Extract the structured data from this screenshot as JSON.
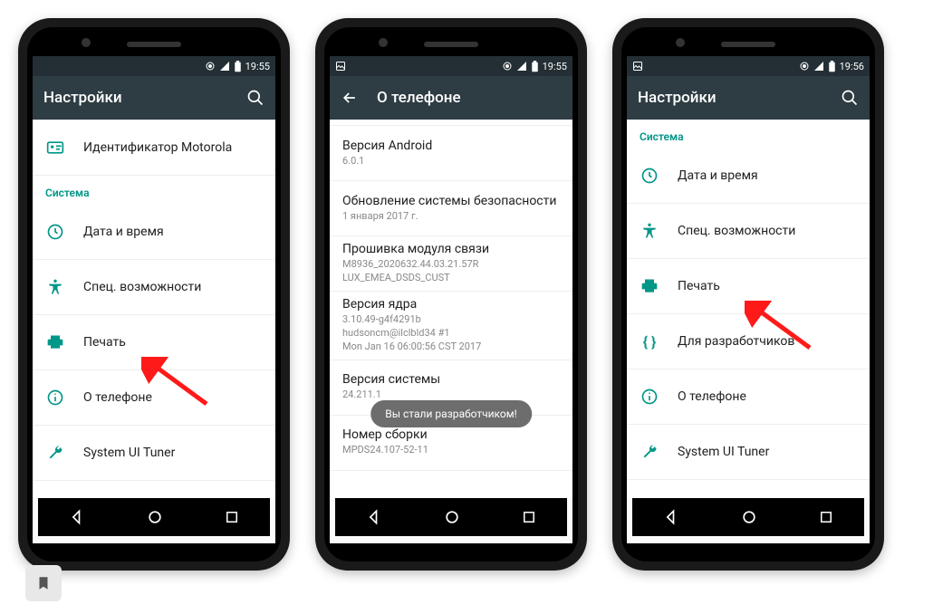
{
  "colors": {
    "accent": "#009688",
    "appbar": "#2e3c43",
    "statusbar": "#232f34"
  },
  "phone1": {
    "time": "19:55",
    "title": "Настройки",
    "top_item": "Идентификатор Motorola",
    "section": "Система",
    "items": [
      {
        "label": "Дата и время",
        "icon": "clock"
      },
      {
        "label": "Спец. возможности",
        "icon": "accessibility"
      },
      {
        "label": "Печать",
        "icon": "print"
      },
      {
        "label": "О телефоне",
        "icon": "info"
      },
      {
        "label": "System UI Tuner",
        "icon": "wrench"
      }
    ]
  },
  "phone2": {
    "time": "19:55",
    "title": "О телефоне",
    "toast": "Вы стали разработчиком!",
    "items": [
      {
        "title": "Версия Android",
        "sub": "6.0.1"
      },
      {
        "title": "Обновление системы безопасности",
        "sub": "1 января 2017 г."
      },
      {
        "title": "Прошивка модуля связи",
        "sub": "M8936_2020632.44.03.21.57R\nLUX_EMEA_DSDS_CUST"
      },
      {
        "title": "Версия ядра",
        "sub": "3.10.49-g4f4291b\nhudsoncm@ilclbld34 #1\nMon Jan 16 06:00:56 CST 2017"
      },
      {
        "title": "Версия системы",
        "sub": "24.211.1"
      },
      {
        "title": "Номер сборки",
        "sub": "MPDS24.107-52-11"
      }
    ]
  },
  "phone3": {
    "time": "19:56",
    "title": "Настройки",
    "section": "Система",
    "items": [
      {
        "label": "Дата и время",
        "icon": "clock"
      },
      {
        "label": "Спец. возможности",
        "icon": "accessibility"
      },
      {
        "label": "Печать",
        "icon": "print"
      },
      {
        "label": "Для разработчиков",
        "icon": "braces"
      },
      {
        "label": "О телефоне",
        "icon": "info"
      },
      {
        "label": "System UI Tuner",
        "icon": "wrench"
      }
    ]
  }
}
